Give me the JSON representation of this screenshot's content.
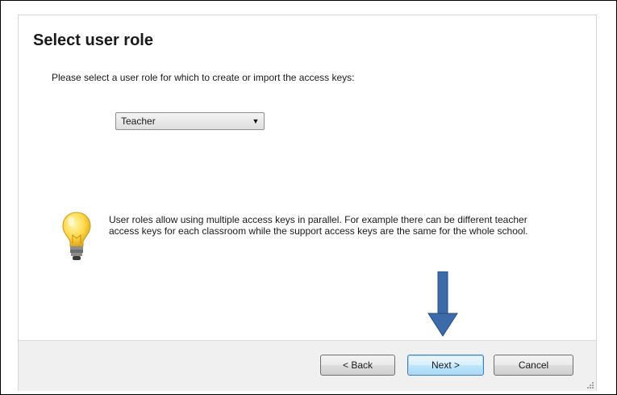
{
  "dialog": {
    "title": "Select user role",
    "instruction": "Please select a user role for which to create or import the access keys:",
    "role_select": {
      "selected": "Teacher"
    },
    "tip": {
      "icon": "lightbulb-icon",
      "text": "User roles allow using multiple access keys in parallel. For example there can be different teacher access keys for each classroom while the support access keys are the same for the whole school."
    },
    "buttons": {
      "back": "< Back",
      "next": "Next >",
      "cancel": "Cancel"
    }
  },
  "annotation": {
    "icon": "down-arrow-icon",
    "color": "#3d6aa8"
  }
}
